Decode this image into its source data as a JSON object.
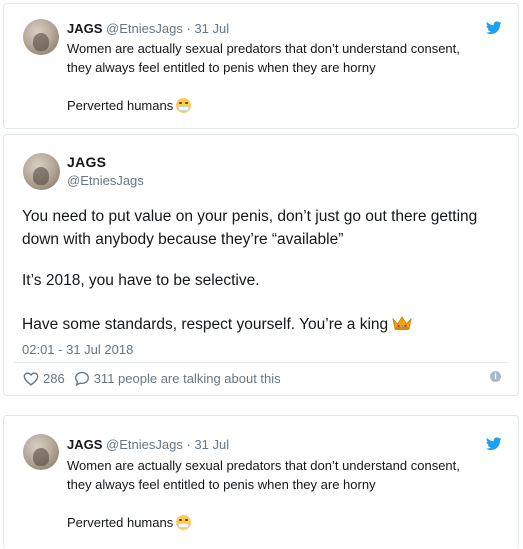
{
  "tweet_top": {
    "name": "JAGS",
    "handle": "@EtniesJags",
    "separator": "·",
    "date": "31 Jul",
    "line1": "Women are actually sexual predators that don’t understand consent,",
    "line2": "they always feel entitled to penis when they are horny",
    "line3": "Perverted humans",
    "emoji": "face-with-medical-mask"
  },
  "tweet_main": {
    "name": "JAGS",
    "handle": "@EtniesJags",
    "line1": "You need to put value on your penis, don’t just go out there getting",
    "line2": "down with anybody because they’re “available”",
    "line3": "It’s 2018, you have to be selective.",
    "line4": "Have some standards, respect yourself. You’re a king",
    "emoji": "crown",
    "timestamp": "02:01 - 31 Jul 2018",
    "likes": "286",
    "comments_text": "311 people are talking about this",
    "info_glyph": "i"
  },
  "tweet_bottom": {
    "name": "JAGS",
    "handle": "@EtniesJags",
    "separator": "·",
    "date": "31 Jul",
    "line1": "Women are actually sexual predators that don’t understand consent,",
    "line2": "they always feel entitled to penis when they are horny",
    "line3": "Perverted humans",
    "emoji": "face-with-medical-mask"
  },
  "colors": {
    "twitter_blue": "#1da1f2",
    "text_primary": "#14171a",
    "text_secondary": "#657786",
    "border": "#e1e8ed"
  }
}
